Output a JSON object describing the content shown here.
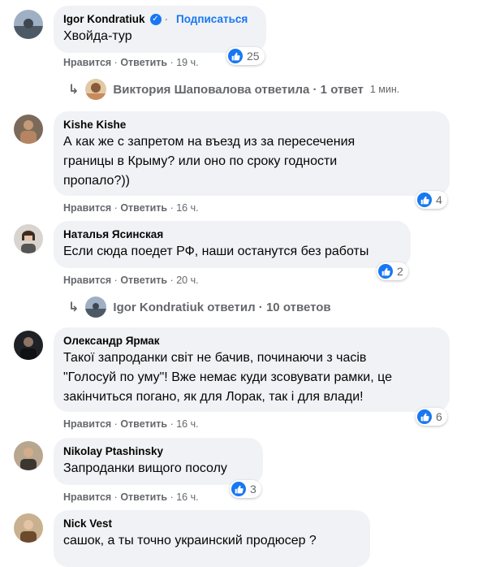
{
  "labels": {
    "like": "Нравится",
    "reply": "Ответить",
    "dot": "·"
  },
  "comments": [
    {
      "author": "Igor Kondratiuk",
      "subscribe": "Подписаться",
      "text": "Хвойда-тур",
      "time": "19 ч.",
      "likes": "25",
      "reply_thread": {
        "text": "Виктория Шаповалова ответила · 1 ответ",
        "time": "1 мин."
      }
    },
    {
      "author": "Kishe Kishe",
      "text_lines": [
        "А как же с запретом на въезд из за пересечения",
        "границы в Крыму? или оно по сроку годности",
        "пропало?))"
      ],
      "time": "16 ч.",
      "likes": "4"
    },
    {
      "author": "Наталья Ясинская",
      "text": "Если сюда поедет РФ, наши останутся без работы",
      "time": "20 ч.",
      "likes": "2",
      "reply_thread": {
        "text": "Igor Kondratiuk ответил · 10 ответов"
      }
    },
    {
      "author": "Олександр Ярмак",
      "text_lines": [
        "Такої запроданки світ не бачив, починаючи з часів",
        "\"Голосуй по уму\"! Вже немає куди зсовувати рамки, це",
        "закінчиться погано, як для Лорак, так і для влади!"
      ],
      "time": "16 ч.",
      "likes": "6"
    },
    {
      "author": "Nikolay Ptashinsky",
      "text": "Запроданки вищого посолу",
      "time": "16 ч.",
      "likes": "3"
    },
    {
      "author": "Nick Vest",
      "text": "сашок, а ты точно украинский продюсер ?"
    }
  ],
  "colors": {
    "accent": "#1877f2",
    "bubble": "#f0f2f5",
    "secondary_text": "#65676b"
  },
  "icons": [
    "verified-badge-icon",
    "like-icon",
    "reply-arrow-icon"
  ]
}
